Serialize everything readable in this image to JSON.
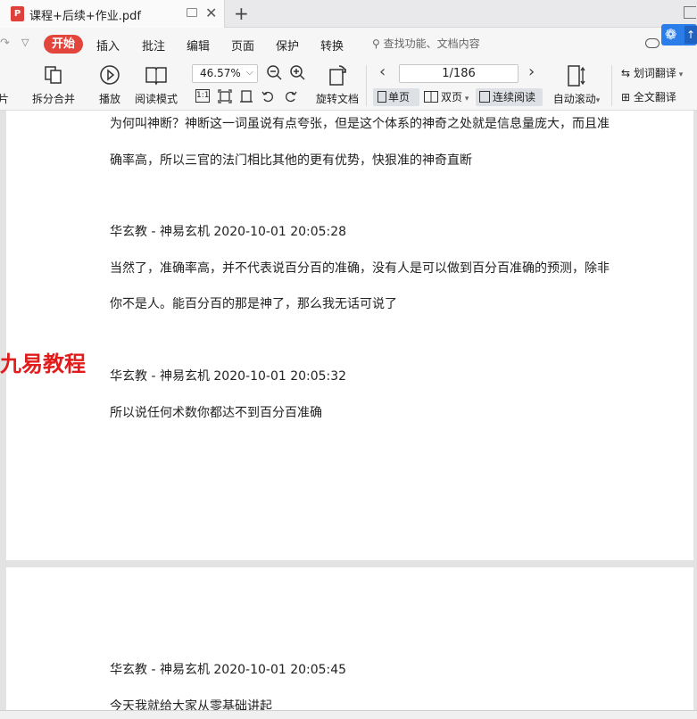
{
  "tab": {
    "title": "课程+后续+作业.pdf",
    "icon": "pdf-icon"
  },
  "menubar": {
    "start": "开始",
    "items": [
      "插入",
      "批注",
      "编辑",
      "页面",
      "保护",
      "转换"
    ],
    "search_placeholder": "查找功能、文档内容"
  },
  "toolbar": {
    "image_label_partial": "图片",
    "split_merge": "拆分合并",
    "play": "播放",
    "read_mode": "阅读模式",
    "zoom": "46.57%",
    "rotate_doc": "旋转文档",
    "page_indicator": "1/186",
    "single_page": "单页",
    "double_page": "双页",
    "continuous": "连续阅读",
    "auto_scroll": "自动滚动",
    "word_translate": "划词翻译",
    "full_translate": "全文翻译",
    "fit_label": "1:1"
  },
  "document": {
    "watermark": "九易教程",
    "page1": [
      {
        "text": "为何叫神断？神断这一词虽说有点夸张，但是这个体系的神奇之处就是信息量庞大，而且准"
      },
      {
        "text": "确率高，所以三官的法门相比其他的更有优势，快狠准的神奇直断"
      },
      {
        "text": "华玄教 - 神易玄机 2020-10-01 20:05:28"
      },
      {
        "text": "当然了，准确率高，并不代表说百分百的准确，没有人是可以做到百分百准确的预测，除非"
      },
      {
        "text": "你不是人。能百分百的那是神了，那么我无话可说了"
      },
      {
        "text": "华玄教 - 神易玄机 2020-10-01 20:05:32"
      },
      {
        "text": "所以说任何术数你都达不到百分百准确"
      }
    ],
    "page2": [
      {
        "text": "华玄教 - 神易玄机 2020-10-01 20:05:45"
      },
      {
        "text": "今天我就给大家从零基础讲起"
      }
    ]
  },
  "colors": {
    "accent": "#e2453c",
    "watermark": "#e21b1b",
    "baidu": "#2b7de9"
  }
}
